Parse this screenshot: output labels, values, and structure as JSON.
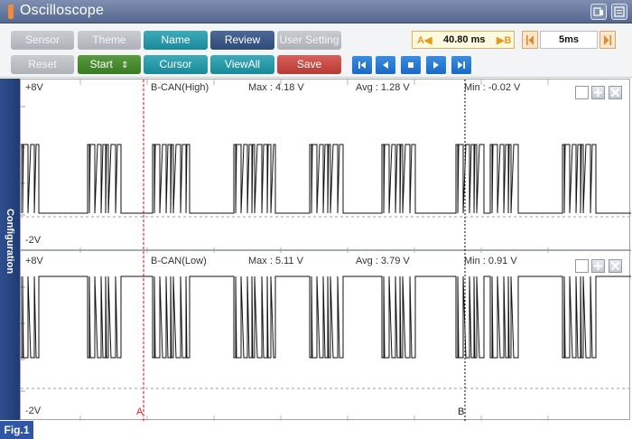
{
  "window": {
    "title": "Oscilloscope"
  },
  "toolbar": {
    "row1": {
      "sensor": "Sensor",
      "theme": "Theme",
      "name": "Name",
      "review": "Review",
      "user_setting": "User Setting"
    },
    "row2": {
      "reset": "Reset",
      "start": "Start",
      "cursor": "Cursor",
      "view_all": "ViewAll",
      "save": "Save"
    },
    "cursor_time": {
      "a_label": "A",
      "value": "40.80 ms",
      "b_label": "B"
    },
    "time_div": "5ms"
  },
  "sidebar": {
    "label": "Configuration"
  },
  "channels": [
    {
      "top_label": "+8V",
      "bottom_label": "-2V",
      "name": "B-CAN(High)",
      "max": "Max : 4.18 V",
      "avg": "Avg : 1.28 V",
      "min": "Min : -0.02 V"
    },
    {
      "top_label": "+8V",
      "bottom_label": "-2V",
      "name": "B-CAN(Low)",
      "max": "Max : 5.11 V",
      "avg": "Avg : 3.79 V",
      "min": "Min : 0.91 V"
    }
  ],
  "cursors": {
    "a": "A",
    "b": "B"
  },
  "figure": {
    "label": "Fig.1"
  },
  "colors": {
    "cursor_a": "#ff0000",
    "cursor_b": "#000000",
    "signal": "#111111",
    "title_bar": "#6677a0",
    "sidebar": "#2a4785"
  }
}
